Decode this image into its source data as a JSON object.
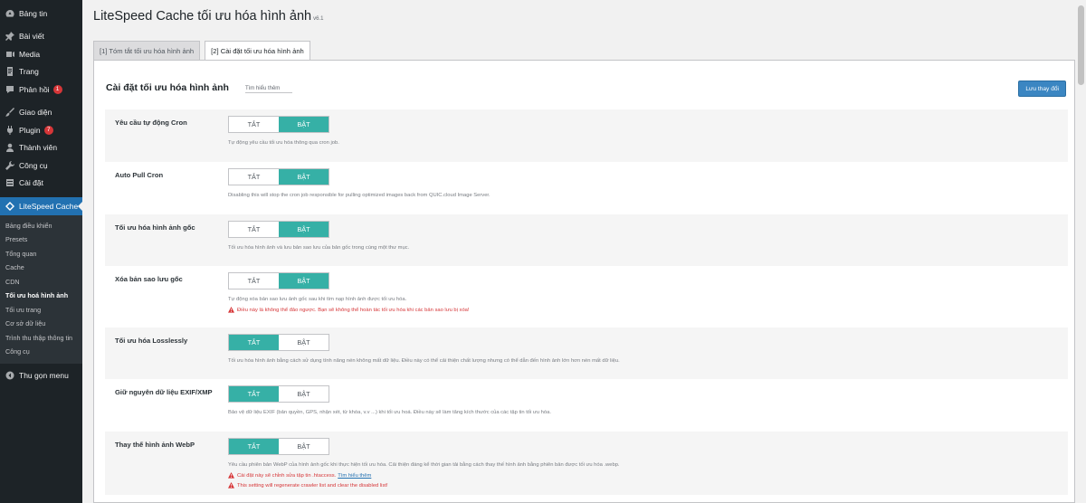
{
  "sidebar": {
    "items": [
      {
        "label": "Bảng tin",
        "icon": "dashboard-icon"
      },
      {
        "label": "Bài viết",
        "icon": "pin-icon"
      },
      {
        "label": "Media",
        "icon": "media-icon"
      },
      {
        "label": "Trang",
        "icon": "page-icon"
      },
      {
        "label": "Phản hồi",
        "icon": "comment-icon",
        "badge": "1"
      },
      {
        "label": "Giao diện",
        "icon": "brush-icon"
      },
      {
        "label": "Plugin",
        "icon": "plugin-icon",
        "badge": "7"
      },
      {
        "label": "Thành viên",
        "icon": "user-icon"
      },
      {
        "label": "Công cụ",
        "icon": "wrench-icon"
      },
      {
        "label": "Cài đặt",
        "icon": "settings-icon"
      }
    ],
    "current": {
      "label": "LiteSpeed Cache",
      "icon": "litespeed-icon"
    },
    "submenu": [
      "Bảng điều khiển",
      "Presets",
      "Tổng quan",
      "Cache",
      "CDN",
      "Tối ưu hoá hình ảnh",
      "Tối ưu trang",
      "Cơ sở dữ liệu",
      "Trình thu thập thông tin",
      "Công cụ"
    ],
    "submenu_active": "Tối ưu hoá hình ảnh",
    "collapse": {
      "label": "Thu gọn menu",
      "icon": "collapse-icon"
    }
  },
  "page": {
    "title": "LiteSpeed Cache tối ưu hóa hình ảnh",
    "version": "v6.1",
    "tabs": [
      {
        "label": "[1] Tóm tắt tối ưu hóa hình ảnh",
        "active": false
      },
      {
        "label": "[2] Cài đặt tối ưu hóa hình ảnh",
        "active": true
      }
    ],
    "section_title": "Cài đặt tối ưu hóa hình ảnh",
    "learn_more": "Tìm hiểu thêm",
    "save_label": "Lưu thay đổi",
    "off_label": "TẮT",
    "on_label": "BẬT"
  },
  "settings": [
    {
      "label": "Yêu cầu tự động Cron",
      "enabled": true,
      "desc": "Tự động yêu cầu tối ưu hóa thông qua cron job."
    },
    {
      "label": "Auto Pull Cron",
      "enabled": true,
      "desc": "Disabling this will stop the cron job responsible for pulling optimized images back from QUIC.cloud Image Server."
    },
    {
      "label": "Tối ưu hóa hình ảnh gốc",
      "enabled": true,
      "desc": "Tối ưu hóa hình ảnh và lưu bản sao lưu của bản gốc trong cùng một thư mục."
    },
    {
      "label": "Xóa bản sao lưu gốc",
      "enabled": true,
      "desc": "Tự động xóa bản sao lưu ảnh gốc sau khi tìm nạp hình ảnh được tối ưu hóa.",
      "warnings": [
        {
          "text": "Điều này là không thể đảo ngược. Bạn sẽ không thể hoàn tác tối ưu hóa khi các bản sao lưu bị xóa!"
        }
      ]
    },
    {
      "label": "Tối ưu hóa Losslessly",
      "enabled": false,
      "desc": "Tối ưu hóa hình ảnh bằng cách sử dụng tính năng nén không mất dữ liệu. Điều này có thể cải thiện chất lượng nhưng có thể dẫn đến hình ảnh lớn hơn nén mất dữ liệu."
    },
    {
      "label": "Giữ nguyên dữ liệu EXIF/XMP",
      "enabled": false,
      "desc": "Bảo vệ dữ liệu EXIF (bản quyền, GPS, nhận xét, từ khóa, v.v ...) khi tối ưu hoá. Điều này sẽ làm tăng kích thước của các tập tin tối ưu hóa."
    },
    {
      "label": "Thay thế hình ảnh WebP",
      "enabled": false,
      "desc": "Yêu cầu phiên bản WebP của hình ảnh gốc khi thực hiện tối ưu hóa. Cải thiện đáng kể thời gian tải bằng cách thay thế hình ảnh bằng phiên bản được tối ưu hóa .webp.",
      "warnings": [
        {
          "text": "Cài đặt này sẽ chỉnh sửa tập tin .htaccess.",
          "link": "Tìm hiểu thêm"
        },
        {
          "text": "This setting will regenerate crawler list and clear the disabled list!"
        }
      ]
    }
  ]
}
